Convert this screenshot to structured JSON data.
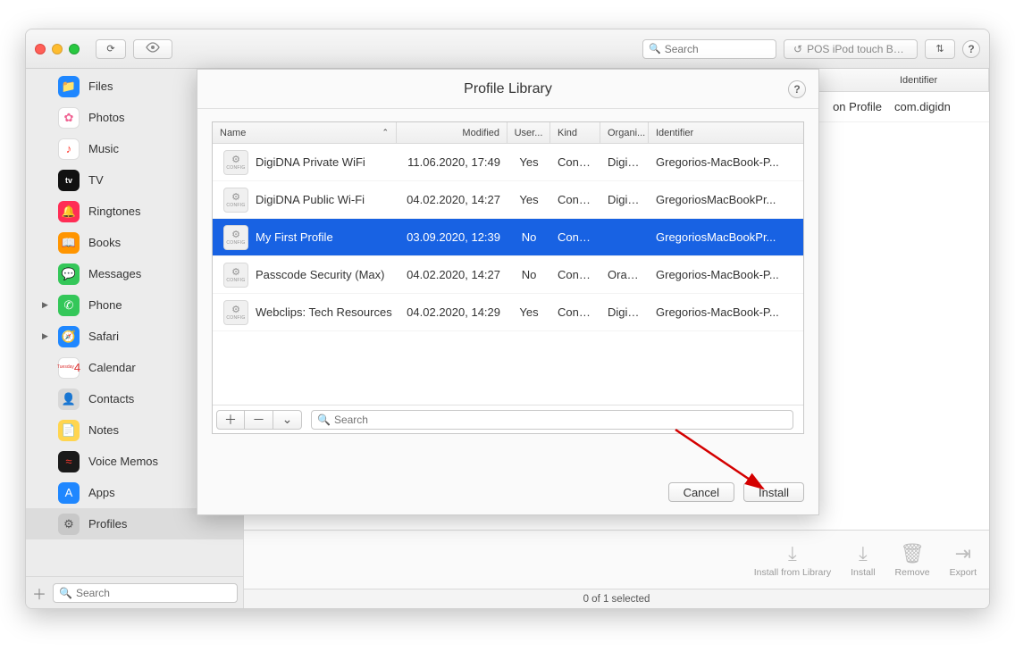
{
  "toolbar": {
    "search_placeholder": "Search",
    "backup_button": "POS iPod touch Backups",
    "sort_glyph": "⇅",
    "help_glyph": "?",
    "refresh_glyph": "⟳",
    "eye_glyph": "👁"
  },
  "sidebar": {
    "items": [
      {
        "label": "Files",
        "icon": "📁",
        "bg": "#1f87ff"
      },
      {
        "label": "Photos",
        "icon": "✿",
        "bg": "#ffffff",
        "fg": "#f06292",
        "border": true
      },
      {
        "label": "Music",
        "icon": "♪",
        "bg": "#ffffff",
        "fg": "#ff3b30",
        "border": true
      },
      {
        "label": "TV",
        "icon": "tv",
        "bg": "#111111"
      },
      {
        "label": "Ringtones",
        "icon": "🔔",
        "bg": "#ff2d55"
      },
      {
        "label": "Books",
        "icon": "📖",
        "bg": "#ff9500"
      },
      {
        "label": "Messages",
        "icon": "💬",
        "bg": "#34c759"
      },
      {
        "label": "Phone",
        "icon": "✆",
        "bg": "#34c759",
        "disclosure": true
      },
      {
        "label": "Safari",
        "icon": "🧭",
        "bg": "#1f87ff",
        "disclosure": true
      },
      {
        "label": "Calendar",
        "icon": "4",
        "bg": "#ffffff",
        "fg": "#d33",
        "border": true,
        "sub": "Tuesday"
      },
      {
        "label": "Contacts",
        "icon": "👤",
        "bg": "#d8d8d8",
        "fg": "#777"
      },
      {
        "label": "Notes",
        "icon": "📄",
        "bg": "#ffd54f",
        "fg": "#333"
      },
      {
        "label": "Voice Memos",
        "icon": "≈",
        "bg": "#1a1a1a",
        "fg": "#ff3b30"
      },
      {
        "label": "Apps",
        "icon": "A",
        "bg": "#1f87ff"
      },
      {
        "label": "Profiles",
        "icon": "⚙",
        "bg": "#c8c8c8",
        "fg": "#555",
        "selected": true
      }
    ],
    "search_placeholder": "Search",
    "add_glyph": "＋"
  },
  "main": {
    "columns": {
      "identifier": "Identifier"
    },
    "row": {
      "name": "on Profile",
      "identifier": "com.digidn"
    },
    "actions": [
      {
        "key": "install-library",
        "label": "Install from Library",
        "glyph": "⤓"
      },
      {
        "key": "install",
        "label": "Install",
        "glyph": "⤓"
      },
      {
        "key": "remove",
        "label": "Remove",
        "glyph": "🗑"
      },
      {
        "key": "export",
        "label": "Export",
        "glyph": "⇥"
      }
    ]
  },
  "modal": {
    "title": "Profile Library",
    "help_glyph": "?",
    "columns": {
      "name": "Name",
      "modified": "Modified",
      "user": "User...",
      "kind": "Kind",
      "org": "Organi...",
      "identifier": "Identifier"
    },
    "sort_indicator": "⌃",
    "rows": [
      {
        "name": "DigiDNA Private WiFi",
        "modified": "11.06.2020, 17:49",
        "user": "Yes",
        "kind": "Config...",
        "org": "DigiD...",
        "identifier": "Gregorios-MacBook-P..."
      },
      {
        "name": "DigiDNA Public Wi-Fi",
        "modified": "04.02.2020, 14:27",
        "user": "Yes",
        "kind": "Config...",
        "org": "DigiD...",
        "identifier": "GregoriosMacBookPr..."
      },
      {
        "name": "My First Profile",
        "modified": "03.09.2020, 12:39",
        "user": "No",
        "kind": "Config...",
        "org": "",
        "identifier": "GregoriosMacBookPr...",
        "selected": true
      },
      {
        "name": "Passcode Security (Max)",
        "modified": "04.02.2020, 14:27",
        "user": "No",
        "kind": "Config...",
        "org": "Orange",
        "identifier": "Gregorios-MacBook-P..."
      },
      {
        "name": "Webclips: Tech Resources",
        "modified": "04.02.2020, 14:29",
        "user": "Yes",
        "kind": "Config...",
        "org": "DigiD...",
        "identifier": "Gregorios-MacBook-P..."
      }
    ],
    "tool": {
      "add": "＋",
      "remove": "－",
      "sel": "⌄"
    },
    "search_placeholder": "Search",
    "buttons": {
      "cancel": "Cancel",
      "install": "Install"
    }
  },
  "status": {
    "text": "0 of 1 selected"
  }
}
